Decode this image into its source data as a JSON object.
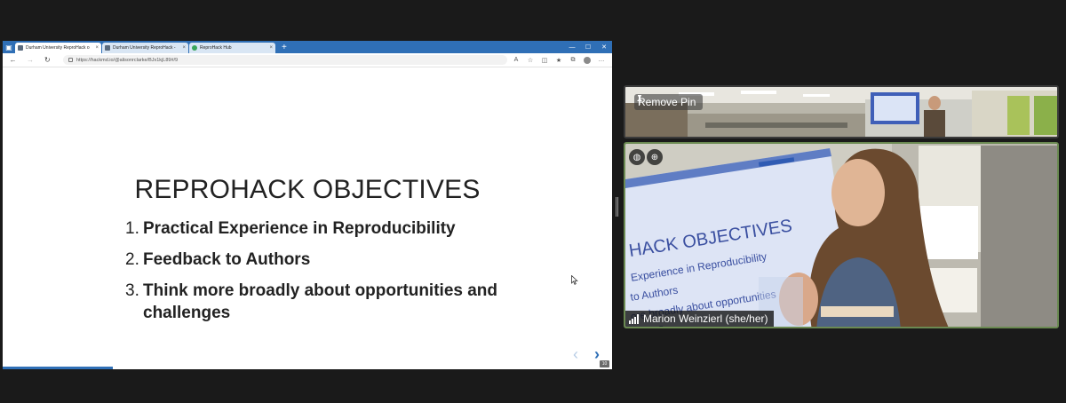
{
  "browser": {
    "tabs": [
      {
        "label": "Durham University ReproHack o",
        "active": true,
        "close": "×"
      },
      {
        "label": "Durham University ReproHack - ",
        "active": false,
        "close": "×"
      },
      {
        "label": "ReproHack Hub",
        "active": false,
        "close": "×"
      }
    ],
    "new_tab": "+",
    "window_controls": {
      "minimize": "—",
      "maximize": "☐",
      "close": "✕"
    },
    "nav": {
      "back": "←",
      "forward": "→",
      "reload": "↻"
    },
    "url": "https://hackmd.io/@alisonrclarke/BJx1kjL89#/9",
    "toolbar_icons": [
      "read-aloud-icon",
      "favorite-add-icon",
      "extensions-icon",
      "favorites-icon",
      "collections-icon",
      "profile-icon",
      "more-icon"
    ]
  },
  "slide": {
    "title": "REPROHACK OBJECTIVES",
    "objectives": [
      {
        "num": "1.",
        "text": "Practical Experience in Reproducibility"
      },
      {
        "num": "2.",
        "text": "Feedback to Authors"
      },
      {
        "num": "3.",
        "text": "Think more broadly about opportunities and challenges"
      }
    ],
    "prev_arrow": "‹",
    "next_arrow": "›",
    "slide_number": "10"
  },
  "video": {
    "pinned_tile": {
      "pin_label": "Remove Pin"
    },
    "speaker_tile": {
      "name": "Marion Weinzierl (she/her)"
    }
  },
  "colors": {
    "edge_blue": "#2f6fb6",
    "stage_bg": "#1a1a1a",
    "speaker_border": "#6b8a52"
  }
}
